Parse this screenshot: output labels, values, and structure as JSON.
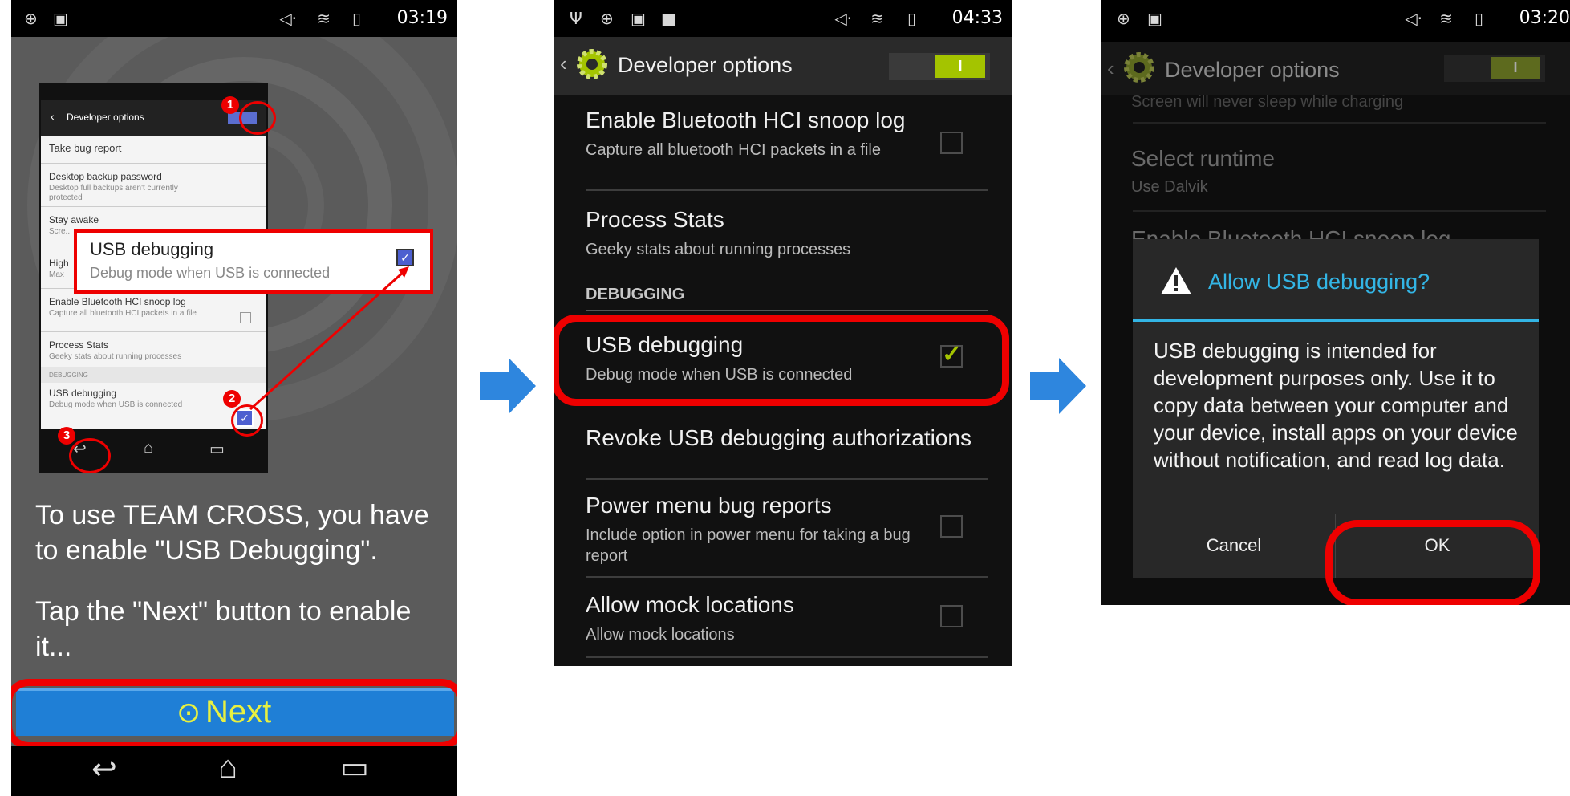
{
  "colors": {
    "accent_blue": "#33b5e5",
    "check_green": "#a4c400",
    "highlight_red": "#ee0000",
    "next_blue": "#1f7fd6"
  },
  "phone1": {
    "status_time": "03:19",
    "inner": {
      "title": "Developer options",
      "items": [
        {
          "title": "Take bug report",
          "subtitle": ""
        },
        {
          "title": "Desktop backup password",
          "subtitle": "Desktop full backups aren't currently protected"
        },
        {
          "title": "Stay awake",
          "subtitle": "Scre..."
        },
        {
          "title": "High",
          "subtitle": "Max"
        },
        {
          "title": "Enable Bluetooth HCI snoop log",
          "subtitle": "Capture all bluetooth HCI packets in a file"
        },
        {
          "title": "Process Stats",
          "subtitle": "Geeky stats about running processes"
        }
      ],
      "section": "DEBUGGING",
      "usb_title": "USB debugging",
      "usb_subtitle": "Debug mode when USB is connected",
      "badges": [
        "1",
        "2",
        "3"
      ]
    },
    "callout": {
      "title": "USB debugging",
      "subtitle": "Debug mode when USB is connected"
    },
    "instructions_1": "To use TEAM CROSS, you have to enable \"USB Debugging\".",
    "instructions_2": "Tap the \"Next\" button to enable it...",
    "next_label": "Next",
    "next_icon": "circle-chevron-icon"
  },
  "phone2": {
    "status_time": "04:33",
    "title": "Developer options",
    "toggle_label": "I",
    "items": [
      {
        "title": "Enable Bluetooth HCI snoop log",
        "subtitle": "Capture all bluetooth HCI packets in a file"
      },
      {
        "title": "Process Stats",
        "subtitle": "Geeky stats about running processes"
      }
    ],
    "section": "DEBUGGING",
    "usb_title": "USB debugging",
    "usb_subtitle": "Debug mode when USB is connected",
    "revoke": "Revoke USB debugging authorizations",
    "power_title": "Power menu bug reports",
    "power_subtitle": "Include option in power menu for taking a bug report",
    "mock_title": "Allow mock locations",
    "mock_subtitle": "Allow mock locations"
  },
  "phone3": {
    "status_time": "03:20",
    "title": "Developer options",
    "toggle_label": "I",
    "bg_items": {
      "screen_text": "Screen will never sleep while charging",
      "runtime_title": "Select runtime",
      "runtime_sub": "Use Dalvik",
      "bt_title": "Enable Bluetooth HCI snoop log"
    },
    "dialog": {
      "title": "Allow USB debugging?",
      "body": "USB debugging is intended for development purposes only. Use it to copy data between your computer and your device, install apps on your device without notification, and read log data.",
      "cancel": "Cancel",
      "ok": "OK"
    }
  }
}
